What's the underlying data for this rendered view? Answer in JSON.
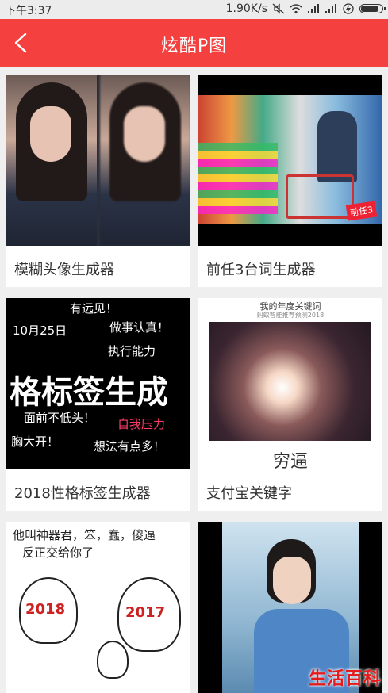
{
  "status_bar": {
    "time": "下午3:37",
    "network_speed": "1.90K/s",
    "battery_level": 0.92
  },
  "header": {
    "title": "炫酷P图",
    "accent_color": "#f4403f"
  },
  "cards": [
    {
      "label": "模糊头像生成器"
    },
    {
      "label": "前任3台词生成器"
    },
    {
      "label": "2018性格标签生成器"
    },
    {
      "label": "支付宝关键字"
    },
    {
      "label": ""
    },
    {
      "label": ""
    }
  ],
  "thumb_texts": {
    "card2_logo": "前任3",
    "card3_big": "格标签生成",
    "card3_line1": "有远见！",
    "card3_line2": "做事认真！",
    "card3_line3": "执行能力",
    "card3_line4": "10月25日",
    "card3_line5": "面前不低头！",
    "card3_line6": "自我压力",
    "card3_line7": "想法有点多！",
    "card3_line8": "胸大开！",
    "card4_header": "我的年度关键词",
    "card4_sub": "蚂蚁智能推荐预测2018",
    "card4_caption": "穷逼",
    "card5_line1": "他叫神器君，笨，蠢，傻逼",
    "card5_line2": "反正交给你了",
    "card5_year_a": "2018",
    "card5_year_b": "2017"
  },
  "watermark": "生活百科"
}
